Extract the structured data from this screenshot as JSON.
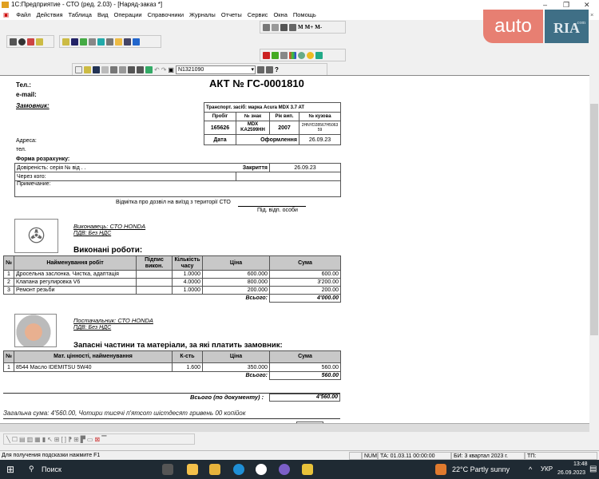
{
  "window": {
    "title": "1С:Предприятие - СТО (ред. 2.03) - [Наряд-заказ  *]",
    "minimize": "–",
    "restore": "❐",
    "close": "✕",
    "doc_close": "×"
  },
  "menu": [
    "Файл",
    "Действия",
    "Таблица",
    "Вид",
    "Операции",
    "Справочники",
    "Журналы",
    "Отчеты",
    "Сервис",
    "Окна",
    "Помощь"
  ],
  "toolbar": {
    "search_value": "N1321090",
    "m_buttons": [
      "M",
      "M+",
      "M-"
    ]
  },
  "watermark": {
    "text1": "auto",
    "text2": "RIA",
    "text3": ".com"
  },
  "doc": {
    "tel": "Тел.:",
    "email": "e-mail:",
    "title": "АКТ №  ГС-0001810",
    "customer": "Замовник:",
    "address": "Адреса:",
    "tel2": "тел.",
    "vehicle": {
      "caption": "Транспорт. засіб: марка Acura MDX 3.7 AT",
      "headers": [
        "Пробіг",
        "№ знак",
        "Рік вип.",
        "№ кузова"
      ],
      "values": [
        "165626",
        "MDX KA2599HH",
        "2007",
        "2HNYD28567H506359"
      ],
      "date_label": "Дата",
      "reg_label": "Оформлення",
      "reg_date": "26.09.23"
    },
    "payment_form": "Форма розрахунку:",
    "trust": "Довіреність: серія    №    від    .  .",
    "closing_label": "Закриття",
    "closing_date": "26.09.23",
    "via": "Через кого:",
    "note": "Примечание:",
    "exit_mark": "Відмітка про дозвіл на виїзд з території СТО",
    "resp": "Під. відп. особи",
    "executor": "Виконавець:   СТО  HONDA",
    "vat1": "ПДВ:  Без НДС",
    "works_title": "Виконані роботи:",
    "works": {
      "headers": [
        "№",
        "Найменування робіт",
        "Підпис викон.",
        "Кількість часу",
        "Ціна",
        "Сума"
      ],
      "rows": [
        [
          "1",
          "Дросельна заслонка. Чистка, адаптація",
          "",
          "1.0000",
          "600.000",
          "600.00"
        ],
        [
          "2",
          "Клапана регулировка V6",
          "",
          "4.0000",
          "800.000",
          "3'200.00"
        ],
        [
          "3",
          "Ремонт резьби",
          "",
          "1.0000",
          "200.000",
          "200.00"
        ]
      ],
      "total_label": "Всього:",
      "total": "4'000.00"
    },
    "supplier": "Постачальник:   СТО  HONDA",
    "vat2": "ПДВ:  Без НДС",
    "parts_title": "Запасні частини та матеріали, за які платить замовник:",
    "parts": {
      "headers": [
        "№",
        "Мат. цінності, найменування",
        "К-сть",
        "Ціна",
        "Сума"
      ],
      "rows": [
        [
          "1",
          "8544 Масло IDEMITSU 5W40",
          "1.600",
          "350.000",
          "560.00"
        ]
      ],
      "total_label": "Всього:",
      "total": "560.00"
    },
    "doc_total_label": "Всього (по документу) :",
    "doc_total": "4'560.00",
    "sum_words": "Загальна сума:  4'560.00, Чотири тисячі п'ятсот шістдесят гривень 00 копійок"
  },
  "status": {
    "hint": "Для получения подсказки нажмите F1",
    "num": "NUM",
    "ta": "ТА: 01.03.11  00:00:00",
    "bi": "БИ: 3 квартал 2023 г.",
    "tp": "ТП:"
  },
  "taskbar": {
    "search": "Поиск",
    "weather": "22°C  Partly sunny",
    "lang": "УКР",
    "time": "13:48",
    "date": "26.09.2023"
  }
}
